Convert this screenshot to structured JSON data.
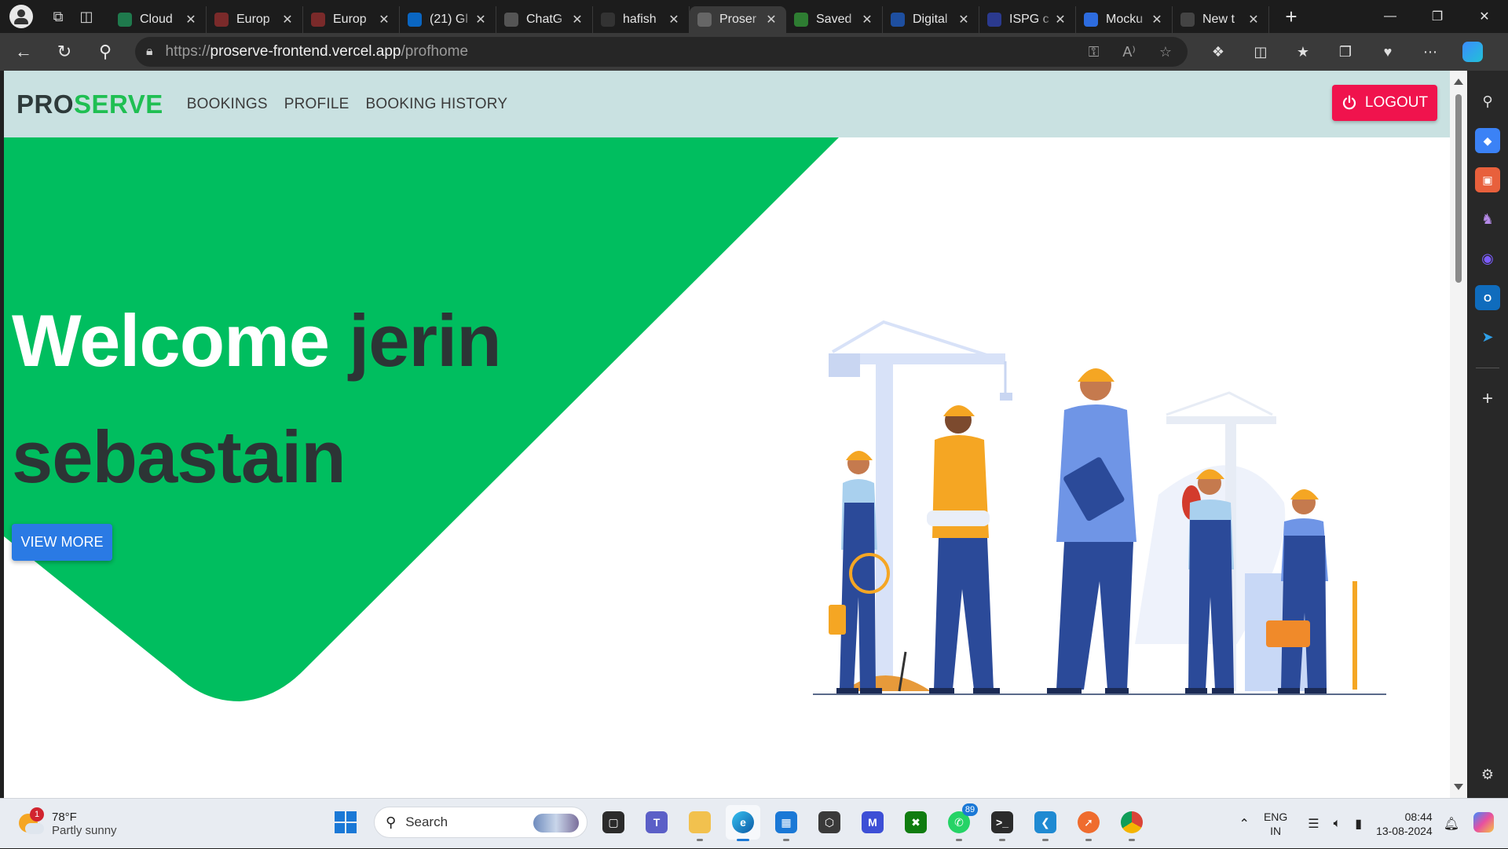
{
  "browser": {
    "tabs": [
      {
        "title": "Cloud",
        "favicon_color": "#1f7a4d"
      },
      {
        "title": "Europ",
        "favicon_color": "#7a2a2a"
      },
      {
        "title": "Europ",
        "favicon_color": "#7a2a2a"
      },
      {
        "title": "(21) Gl",
        "favicon_color": "#0a66c2"
      },
      {
        "title": "ChatG",
        "favicon_color": "#555555"
      },
      {
        "title": "hafish",
        "favicon_color": "#333333"
      },
      {
        "title": "Proser",
        "favicon_color": "#666666",
        "active": true
      },
      {
        "title": "Saved",
        "favicon_color": "#2e7d32"
      },
      {
        "title": "Digital",
        "favicon_color": "#1e4fa0"
      },
      {
        "title": "ISPG c",
        "favicon_color": "#2b3a8f"
      },
      {
        "title": "Mocku",
        "favicon_color": "#2d6cdf"
      },
      {
        "title": "New t",
        "favicon_color": "#444444"
      }
    ],
    "url": {
      "scheme": "https://",
      "host": "proserve-frontend.vercel.app",
      "path": "/profhome"
    }
  },
  "site": {
    "brand_pro": "PRO",
    "brand_serve": "SERVE",
    "nav": [
      "BOOKINGS",
      "PROFILE",
      "BOOKING HISTORY"
    ],
    "logout_label": "LOGOUT",
    "welcome_word": "Welcome",
    "user_name": "jerin sebastain",
    "view_more_label": "VIEW MORE",
    "colors": {
      "nav_bg": "#c9e1e1",
      "accent_green": "#00be5f",
      "logout_red": "#f0134d",
      "button_blue": "#2a7ae4"
    }
  },
  "taskbar": {
    "weather_temp": "78°F",
    "weather_condition": "Partly sunny",
    "weather_badge": "1",
    "search_label": "Search",
    "whatsapp_badge": "89",
    "language_top": "ENG",
    "language_bottom": "IN",
    "time": "08:44",
    "date": "13-08-2024"
  }
}
